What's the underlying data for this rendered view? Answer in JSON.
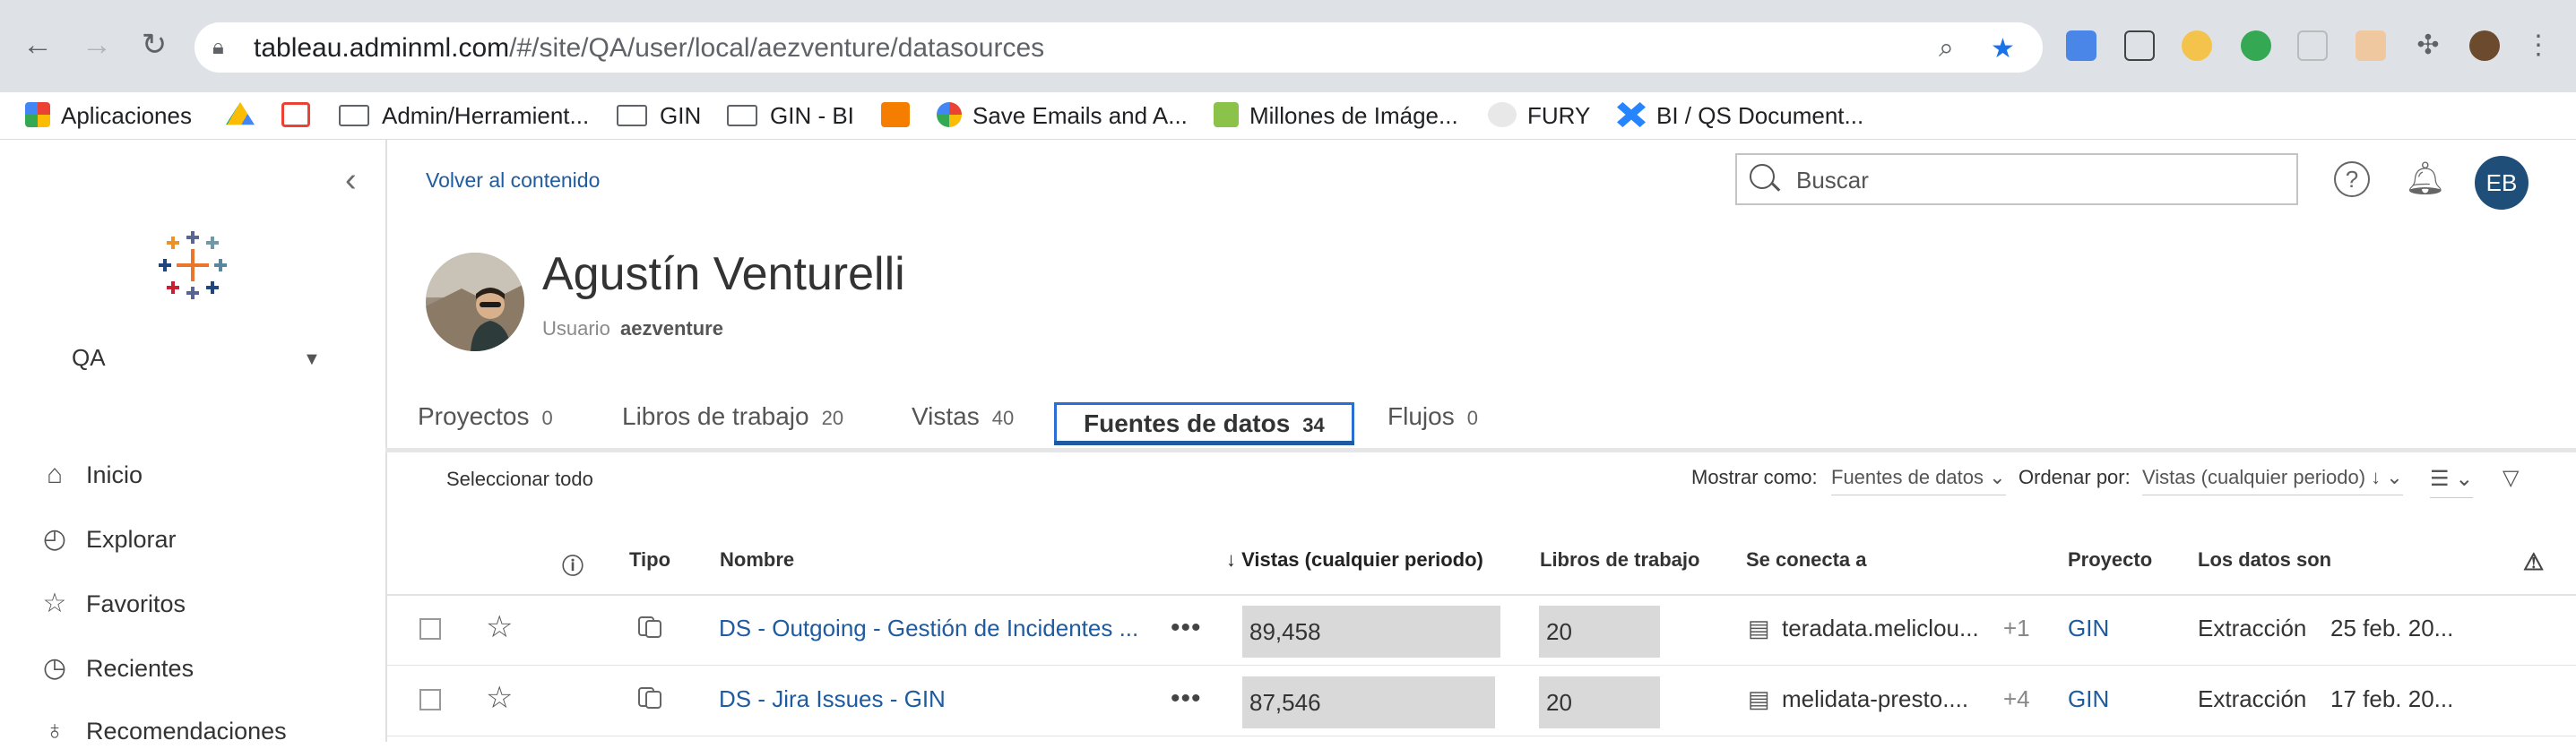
{
  "browser": {
    "url_host": "tableau.adminml.com",
    "url_path": "/#/site/QA/user/local/aezventure/datasources",
    "bookmarks": [
      {
        "label": "Aplicaciones"
      },
      {
        "label": ""
      },
      {
        "label": ""
      },
      {
        "label": "Admin/Herramient..."
      },
      {
        "label": "GIN"
      },
      {
        "label": "GIN - BI"
      },
      {
        "label": ""
      },
      {
        "label": "Save Emails and A..."
      },
      {
        "label": "Millones de Imáge..."
      },
      {
        "label": "FURY"
      },
      {
        "label": "BI / QS Document..."
      }
    ]
  },
  "sidebar": {
    "site": "QA",
    "items": [
      {
        "label": "Inicio",
        "icon": "home-icon"
      },
      {
        "label": "Explorar",
        "icon": "compass-icon"
      },
      {
        "label": "Favoritos",
        "icon": "star-icon"
      },
      {
        "label": "Recientes",
        "icon": "clock-icon"
      },
      {
        "label": "Recomendaciones",
        "icon": "lightbulb-icon"
      }
    ]
  },
  "header": {
    "back_link": "Volver al contenido",
    "search_placeholder": "Buscar",
    "user_initials": "EB"
  },
  "profile": {
    "name": "Agustín Venturelli",
    "role": "Usuario",
    "username": "aezventure"
  },
  "tabs": [
    {
      "label": "Proyectos",
      "count": "0"
    },
    {
      "label": "Libros de trabajo",
      "count": "20"
    },
    {
      "label": "Vistas",
      "count": "40"
    },
    {
      "label": "Fuentes de datos",
      "count": "34"
    },
    {
      "label": "Flujos",
      "count": "0"
    }
  ],
  "toolbar": {
    "select_all": "Seleccionar todo",
    "show_as_label": "Mostrar como:",
    "show_as_value": "Fuentes de datos",
    "sort_label": "Ordenar por:",
    "sort_value": "Vistas (cualquier periodo) ↓"
  },
  "table": {
    "headers": {
      "type": "Tipo",
      "name": "Nombre",
      "views": "↓ Vistas (cualquier periodo)",
      "workbooks": "Libros de trabajo",
      "connects": "Se conecta a",
      "project": "Proyecto",
      "data_kind": "Los datos son"
    },
    "rows": [
      {
        "name": "DS - Outgoing - Gestión de Incidentes ...",
        "views": "89,458",
        "views_fraction": 1.0,
        "workbooks": "20",
        "connects": "teradata.meliclou...",
        "connects_more": "+1",
        "project": "GIN",
        "kind": "Extracción",
        "date": "25 feb. 20..."
      },
      {
        "name": "DS - Jira Issues - GIN",
        "views": "87,546",
        "views_fraction": 0.98,
        "workbooks": "20",
        "connects": "melidata-presto....",
        "connects_more": "+4",
        "project": "GIN",
        "kind": "Extracción",
        "date": "17 feb. 20..."
      }
    ]
  }
}
